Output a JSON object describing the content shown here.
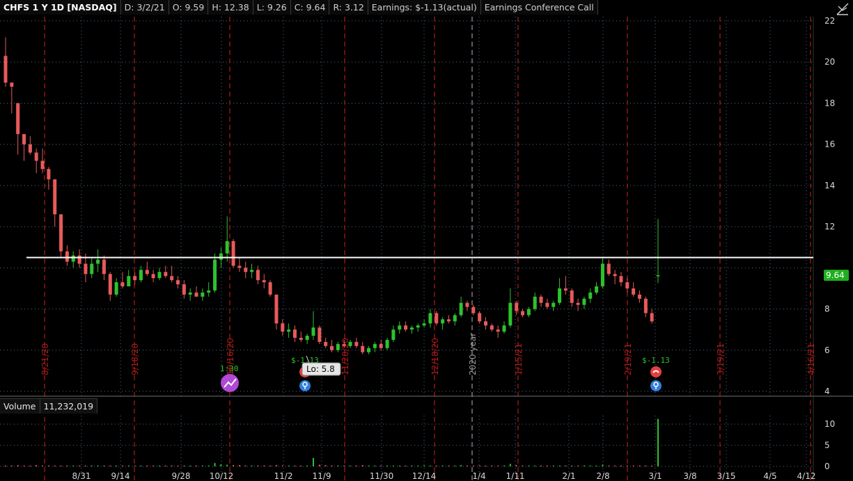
{
  "header": {
    "symbol": "CHFS 1 Y 1D [NASDAQ]",
    "date": "D: 3/2/21",
    "open": "O: 9.59",
    "high": "H: 12.38",
    "low": "L: 9.26",
    "close": "C: 9.64",
    "range": "R: 3.12",
    "earnings": "Earnings: $-1.13(actual)",
    "event": "Earnings Conference Call"
  },
  "volume_header": {
    "label": "Volume",
    "value": "11,232,019"
  },
  "colors": {
    "up": "#2ec22e",
    "down": "#e85a5a",
    "event_line": "#b01c1c",
    "grid": "#4a6f8f",
    "level_line": "#ffffff",
    "price_badge": "#1fae1f"
  },
  "chart_data": {
    "type": "candlestick",
    "price_axis": {
      "min": 4,
      "max": 22,
      "ticks": [
        "4",
        "6",
        "8",
        "10",
        "12",
        "14",
        "16",
        "18",
        "20",
        "22"
      ]
    },
    "volume_axis": {
      "min": 0,
      "max": 12,
      "ticks": [
        "0",
        "5",
        "10"
      ]
    },
    "x_labels": [
      "8/31",
      "9/14",
      "9/28",
      "10/12",
      "11/2",
      "11/9",
      "11/30",
      "12/14",
      "1/4",
      "1/11",
      "2/1",
      "2/8",
      "3/1",
      "3/8",
      "3/15",
      "4/5",
      "4/12"
    ],
    "event_labels": [
      "8/21/20",
      "9/18/20",
      "10/16/20",
      "11/20/20",
      "12/18/20",
      "2020 year",
      "1/15/21",
      "2/19/21",
      "3/19/21",
      "4/16/21"
    ],
    "horizontal_level": 10.5,
    "last_price": "9.64",
    "lo_label": "Lo: 5.8",
    "annotations": [
      "1:30",
      "$-1.13",
      "$-1.13"
    ],
    "candles": [
      [
        20.3,
        21.2,
        18.8,
        19.0
      ],
      [
        19.0,
        19.0,
        17.5,
        18.8
      ],
      [
        18.0,
        18.0,
        15.5,
        16.5
      ],
      [
        16.5,
        16.4,
        15.2,
        16.0
      ],
      [
        16.0,
        16.4,
        15.5,
        15.6
      ],
      [
        15.6,
        15.8,
        14.6,
        15.2
      ],
      [
        15.2,
        15.8,
        14.6,
        14.8
      ],
      [
        14.8,
        14.9,
        13.8,
        14.3
      ],
      [
        14.3,
        14.3,
        12.0,
        12.6
      ],
      [
        12.6,
        12.6,
        10.5,
        10.8
      ],
      [
        10.8,
        11.1,
        10.1,
        10.3
      ],
      [
        10.3,
        10.8,
        10.0,
        10.6
      ],
      [
        10.6,
        10.9,
        10.0,
        10.2
      ],
      [
        10.2,
        10.7,
        9.3,
        9.7
      ],
      [
        9.7,
        10.5,
        9.5,
        10.2
      ],
      [
        10.2,
        10.9,
        9.8,
        10.4
      ],
      [
        10.4,
        10.6,
        9.4,
        9.7
      ],
      [
        9.7,
        9.8,
        8.4,
        8.7
      ],
      [
        8.7,
        9.5,
        8.6,
        9.3
      ],
      [
        9.3,
        9.8,
        9.0,
        9.1
      ],
      [
        9.1,
        9.9,
        9.1,
        9.6
      ],
      [
        9.6,
        9.8,
        9.2,
        9.4
      ],
      [
        9.4,
        10.1,
        9.3,
        9.9
      ],
      [
        9.9,
        10.3,
        9.6,
        9.7
      ],
      [
        9.7,
        9.9,
        9.3,
        9.5
      ],
      [
        9.5,
        10.0,
        9.4,
        9.8
      ],
      [
        9.8,
        10.1,
        9.5,
        9.6
      ],
      [
        9.6,
        10.1,
        9.3,
        9.4
      ],
      [
        9.4,
        9.6,
        9.0,
        9.2
      ],
      [
        9.2,
        9.4,
        8.5,
        8.7
      ],
      [
        8.7,
        9.0,
        8.4,
        8.8
      ],
      [
        8.8,
        9.1,
        8.6,
        8.6
      ],
      [
        8.6,
        9.0,
        8.4,
        8.8
      ],
      [
        8.8,
        9.3,
        8.6,
        8.9
      ],
      [
        8.9,
        10.7,
        8.8,
        10.4
      ],
      [
        10.4,
        11.0,
        10.0,
        10.7
      ],
      [
        10.7,
        12.5,
        10.3,
        11.3
      ],
      [
        11.3,
        11.4,
        10.0,
        10.1
      ],
      [
        10.1,
        10.5,
        9.8,
        10.0
      ],
      [
        10.0,
        10.3,
        9.5,
        9.8
      ],
      [
        9.8,
        10.2,
        9.5,
        9.9
      ],
      [
        9.9,
        10.1,
        9.2,
        9.4
      ],
      [
        9.4,
        9.7,
        9.0,
        9.3
      ],
      [
        9.3,
        9.4,
        8.6,
        8.7
      ],
      [
        8.7,
        8.7,
        7.0,
        7.3
      ],
      [
        7.3,
        7.5,
        6.7,
        6.9
      ],
      [
        6.9,
        7.3,
        6.6,
        7.0
      ],
      [
        7.0,
        7.2,
        6.4,
        6.6
      ],
      [
        6.6,
        6.9,
        6.4,
        6.5
      ],
      [
        6.5,
        6.8,
        6.3,
        6.7
      ],
      [
        6.7,
        7.9,
        6.5,
        7.1
      ],
      [
        7.1,
        7.2,
        6.3,
        6.4
      ],
      [
        6.4,
        6.6,
        6.1,
        6.2
      ],
      [
        6.2,
        6.5,
        5.9,
        6.0
      ],
      [
        6.0,
        6.4,
        5.9,
        6.3
      ],
      [
        6.3,
        6.5,
        6.1,
        6.2
      ],
      [
        6.2,
        6.5,
        6.1,
        6.4
      ],
      [
        6.4,
        6.6,
        6.1,
        6.2
      ],
      [
        6.2,
        6.4,
        5.8,
        5.9
      ],
      [
        5.9,
        6.2,
        5.8,
        6.1
      ],
      [
        6.1,
        6.4,
        5.9,
        6.3
      ],
      [
        6.3,
        6.5,
        6.0,
        6.1
      ],
      [
        6.1,
        6.6,
        6.0,
        6.5
      ],
      [
        6.5,
        7.2,
        6.4,
        7.0
      ],
      [
        7.0,
        7.4,
        6.8,
        7.2
      ],
      [
        7.2,
        7.4,
        6.9,
        7.0
      ],
      [
        7.0,
        7.2,
        6.8,
        7.1
      ],
      [
        7.1,
        7.3,
        6.9,
        7.2
      ],
      [
        7.2,
        7.5,
        7.1,
        7.3
      ],
      [
        7.3,
        8.0,
        7.1,
        7.8
      ],
      [
        7.8,
        7.9,
        7.2,
        7.3
      ],
      [
        7.3,
        7.6,
        7.0,
        7.5
      ],
      [
        7.5,
        7.7,
        7.3,
        7.4
      ],
      [
        7.4,
        7.8,
        7.2,
        7.7
      ],
      [
        7.7,
        8.6,
        7.6,
        8.3
      ],
      [
        8.3,
        8.4,
        7.9,
        8.1
      ],
      [
        8.1,
        8.2,
        7.7,
        7.8
      ],
      [
        7.8,
        7.9,
        7.3,
        7.4
      ],
      [
        7.4,
        7.6,
        7.0,
        7.2
      ],
      [
        7.2,
        7.3,
        6.9,
        7.0
      ],
      [
        7.0,
        7.2,
        6.6,
        6.9
      ],
      [
        6.9,
        7.4,
        6.8,
        7.2
      ],
      [
        7.2,
        9.0,
        7.1,
        8.3
      ],
      [
        8.3,
        8.4,
        7.7,
        7.9
      ],
      [
        7.9,
        8.0,
        7.6,
        7.7
      ],
      [
        7.7,
        8.1,
        7.6,
        8.0
      ],
      [
        8.0,
        8.8,
        7.9,
        8.6
      ],
      [
        8.6,
        8.7,
        8.1,
        8.3
      ],
      [
        8.3,
        8.5,
        8.0,
        8.1
      ],
      [
        8.1,
        8.4,
        7.9,
        8.3
      ],
      [
        8.3,
        9.5,
        8.2,
        9.0
      ],
      [
        9.0,
        9.6,
        8.7,
        8.9
      ],
      [
        8.9,
        9.0,
        8.1,
        8.3
      ],
      [
        8.3,
        8.5,
        7.9,
        8.2
      ],
      [
        8.2,
        8.6,
        8.0,
        8.5
      ],
      [
        8.5,
        9.0,
        8.3,
        8.8
      ],
      [
        8.8,
        9.3,
        8.7,
        9.1
      ],
      [
        9.1,
        10.5,
        9.0,
        10.2
      ],
      [
        10.2,
        10.4,
        9.6,
        9.7
      ],
      [
        9.7,
        9.9,
        9.2,
        9.6
      ],
      [
        9.6,
        9.8,
        9.1,
        9.3
      ],
      [
        9.3,
        9.5,
        8.8,
        9.0
      ],
      [
        9.0,
        9.3,
        8.6,
        8.7
      ],
      [
        8.7,
        8.9,
        8.3,
        8.5
      ],
      [
        8.5,
        8.6,
        7.6,
        7.8
      ],
      [
        7.8,
        8.0,
        7.3,
        7.4
      ],
      [
        9.59,
        12.38,
        9.26,
        9.64
      ]
    ],
    "volume": [
      0.2,
      0.2,
      0.3,
      0.2,
      0.2,
      0.3,
      0.2,
      0.2,
      0.2,
      0.2,
      0.2,
      0.2,
      0.2,
      0.2,
      0.2,
      0.2,
      0.2,
      0.2,
      0.2,
      0.2,
      0.2,
      0.2,
      0.2,
      0.2,
      0.2,
      0.2,
      0.2,
      0.2,
      0.2,
      0.2,
      0.2,
      0.2,
      0.2,
      0.2,
      0.8,
      0.5,
      0.4,
      0.3,
      0.3,
      0.2,
      0.2,
      0.2,
      0.2,
      0.2,
      0.3,
      0.2,
      0.2,
      0.2,
      0.2,
      0.2,
      2.0,
      0.4,
      0.3,
      0.2,
      0.2,
      0.2,
      0.2,
      0.2,
      0.3,
      0.2,
      0.2,
      0.2,
      0.2,
      0.2,
      0.2,
      0.2,
      0.2,
      0.2,
      0.2,
      0.2,
      0.2,
      0.2,
      0.2,
      0.2,
      0.3,
      0.2,
      0.2,
      0.2,
      0.2,
      0.2,
      0.2,
      0.2,
      0.6,
      0.3,
      0.2,
      0.2,
      0.2,
      0.2,
      0.2,
      0.2,
      0.2,
      0.2,
      0.2,
      0.2,
      0.2,
      0.2,
      0.2,
      0.4,
      0.2,
      0.2,
      0.2,
      0.2,
      0.2,
      0.2,
      0.2,
      0.2,
      11.23
    ]
  }
}
